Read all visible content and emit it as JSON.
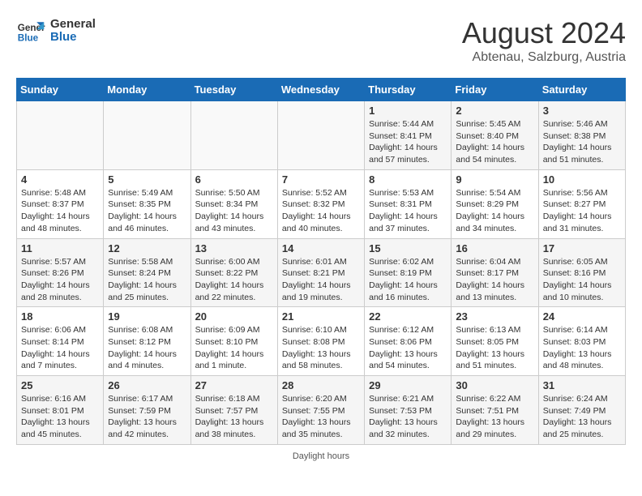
{
  "logo": {
    "line1": "General",
    "line2": "Blue"
  },
  "title": "August 2024",
  "subtitle": "Abtenau, Salzburg, Austria",
  "days_of_week": [
    "Sunday",
    "Monday",
    "Tuesday",
    "Wednesday",
    "Thursday",
    "Friday",
    "Saturday"
  ],
  "footer": "Daylight hours",
  "weeks": [
    [
      {
        "day": "",
        "info": ""
      },
      {
        "day": "",
        "info": ""
      },
      {
        "day": "",
        "info": ""
      },
      {
        "day": "",
        "info": ""
      },
      {
        "day": "1",
        "info": "Sunrise: 5:44 AM\nSunset: 8:41 PM\nDaylight: 14 hours\nand 57 minutes."
      },
      {
        "day": "2",
        "info": "Sunrise: 5:45 AM\nSunset: 8:40 PM\nDaylight: 14 hours\nand 54 minutes."
      },
      {
        "day": "3",
        "info": "Sunrise: 5:46 AM\nSunset: 8:38 PM\nDaylight: 14 hours\nand 51 minutes."
      }
    ],
    [
      {
        "day": "4",
        "info": "Sunrise: 5:48 AM\nSunset: 8:37 PM\nDaylight: 14 hours\nand 48 minutes."
      },
      {
        "day": "5",
        "info": "Sunrise: 5:49 AM\nSunset: 8:35 PM\nDaylight: 14 hours\nand 46 minutes."
      },
      {
        "day": "6",
        "info": "Sunrise: 5:50 AM\nSunset: 8:34 PM\nDaylight: 14 hours\nand 43 minutes."
      },
      {
        "day": "7",
        "info": "Sunrise: 5:52 AM\nSunset: 8:32 PM\nDaylight: 14 hours\nand 40 minutes."
      },
      {
        "day": "8",
        "info": "Sunrise: 5:53 AM\nSunset: 8:31 PM\nDaylight: 14 hours\nand 37 minutes."
      },
      {
        "day": "9",
        "info": "Sunrise: 5:54 AM\nSunset: 8:29 PM\nDaylight: 14 hours\nand 34 minutes."
      },
      {
        "day": "10",
        "info": "Sunrise: 5:56 AM\nSunset: 8:27 PM\nDaylight: 14 hours\nand 31 minutes."
      }
    ],
    [
      {
        "day": "11",
        "info": "Sunrise: 5:57 AM\nSunset: 8:26 PM\nDaylight: 14 hours\nand 28 minutes."
      },
      {
        "day": "12",
        "info": "Sunrise: 5:58 AM\nSunset: 8:24 PM\nDaylight: 14 hours\nand 25 minutes."
      },
      {
        "day": "13",
        "info": "Sunrise: 6:00 AM\nSunset: 8:22 PM\nDaylight: 14 hours\nand 22 minutes."
      },
      {
        "day": "14",
        "info": "Sunrise: 6:01 AM\nSunset: 8:21 PM\nDaylight: 14 hours\nand 19 minutes."
      },
      {
        "day": "15",
        "info": "Sunrise: 6:02 AM\nSunset: 8:19 PM\nDaylight: 14 hours\nand 16 minutes."
      },
      {
        "day": "16",
        "info": "Sunrise: 6:04 AM\nSunset: 8:17 PM\nDaylight: 14 hours\nand 13 minutes."
      },
      {
        "day": "17",
        "info": "Sunrise: 6:05 AM\nSunset: 8:16 PM\nDaylight: 14 hours\nand 10 minutes."
      }
    ],
    [
      {
        "day": "18",
        "info": "Sunrise: 6:06 AM\nSunset: 8:14 PM\nDaylight: 14 hours\nand 7 minutes."
      },
      {
        "day": "19",
        "info": "Sunrise: 6:08 AM\nSunset: 8:12 PM\nDaylight: 14 hours\nand 4 minutes."
      },
      {
        "day": "20",
        "info": "Sunrise: 6:09 AM\nSunset: 8:10 PM\nDaylight: 14 hours\nand 1 minute."
      },
      {
        "day": "21",
        "info": "Sunrise: 6:10 AM\nSunset: 8:08 PM\nDaylight: 13 hours\nand 58 minutes."
      },
      {
        "day": "22",
        "info": "Sunrise: 6:12 AM\nSunset: 8:06 PM\nDaylight: 13 hours\nand 54 minutes."
      },
      {
        "day": "23",
        "info": "Sunrise: 6:13 AM\nSunset: 8:05 PM\nDaylight: 13 hours\nand 51 minutes."
      },
      {
        "day": "24",
        "info": "Sunrise: 6:14 AM\nSunset: 8:03 PM\nDaylight: 13 hours\nand 48 minutes."
      }
    ],
    [
      {
        "day": "25",
        "info": "Sunrise: 6:16 AM\nSunset: 8:01 PM\nDaylight: 13 hours\nand 45 minutes."
      },
      {
        "day": "26",
        "info": "Sunrise: 6:17 AM\nSunset: 7:59 PM\nDaylight: 13 hours\nand 42 minutes."
      },
      {
        "day": "27",
        "info": "Sunrise: 6:18 AM\nSunset: 7:57 PM\nDaylight: 13 hours\nand 38 minutes."
      },
      {
        "day": "28",
        "info": "Sunrise: 6:20 AM\nSunset: 7:55 PM\nDaylight: 13 hours\nand 35 minutes."
      },
      {
        "day": "29",
        "info": "Sunrise: 6:21 AM\nSunset: 7:53 PM\nDaylight: 13 hours\nand 32 minutes."
      },
      {
        "day": "30",
        "info": "Sunrise: 6:22 AM\nSunset: 7:51 PM\nDaylight: 13 hours\nand 29 minutes."
      },
      {
        "day": "31",
        "info": "Sunrise: 6:24 AM\nSunset: 7:49 PM\nDaylight: 13 hours\nand 25 minutes."
      }
    ]
  ]
}
